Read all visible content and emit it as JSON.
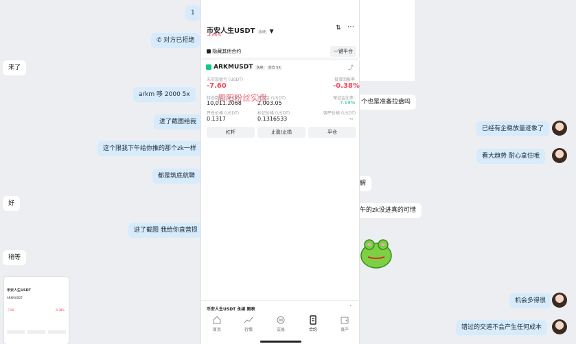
{
  "chat_left": [
    {
      "text": "1"
    },
    {
      "text": "对方已拒绝"
    },
    {
      "text": "来了"
    },
    {
      "text": "arkm  哆  2000  5x"
    },
    {
      "text": "进了截图给我"
    },
    {
      "text": "这个限我下午给你推的那个zk一样"
    },
    {
      "text": "都是筑底航聘"
    },
    {
      "text": "好"
    },
    {
      "text": "进了截图  我给你直营损"
    },
    {
      "text": "稍等"
    }
  ],
  "chat_right": [
    {
      "text": "个也是准备拉盘吗"
    },
    {
      "text": "已经有企稳放量迹象了"
    },
    {
      "text": "看大趋势  耐心拿住哦"
    },
    {
      "text": "解"
    },
    {
      "text": "午的zk没进真的可惜"
    },
    {
      "text": "机会多得很"
    },
    {
      "text": "错过的交道不会产生任何成本"
    }
  ],
  "phone": {
    "title": "币安人生USDT",
    "title_tag": "永续",
    "change": "-4.66%",
    "hide_other": "隐藏其他合约",
    "close_all": "一键平仓",
    "symbol": "ARKMUSDT",
    "tag_perp": "永续",
    "tag_margin": "全仓 5X",
    "pnl_label": "未实现盈亏 (USDT)",
    "pnl_value": "-7.60",
    "roe_label": "投资回报率",
    "roe_value": "-0.38%",
    "watermark": "周阳粉丝实盘",
    "size_label": "持仓数量 (ARKM)",
    "size_value": "10,011.2068",
    "margin_label": "保证金 (USDT)",
    "margin_value": "2,003.05",
    "ratio_label": "保证金比率",
    "ratio_value": "7.19%",
    "entry_label": "开仓价格 (USDT)",
    "entry_value": "0.1317",
    "mark_label": "标记价格 (USDT)",
    "mark_value": "0.1316533",
    "liq_label": "强平价格 (USDT)",
    "liq_value": "--",
    "btn_leverage": "杠杆",
    "btn_tpsl": "止盈/止损",
    "btn_close": "平仓",
    "footer_chart": "币安人生USDT 永续 图表",
    "nav": [
      "首页",
      "行情",
      "交易",
      "合约",
      "资产"
    ]
  },
  "thumb": {
    "title": "币安人生USDT",
    "symbol": "ARKMUSDT",
    "v1": "-7.60",
    "v2": "-0.38%"
  },
  "colors": {
    "red": "#f6465d",
    "green": "#0ecb81",
    "sent_bg": "#d7ebfb"
  }
}
